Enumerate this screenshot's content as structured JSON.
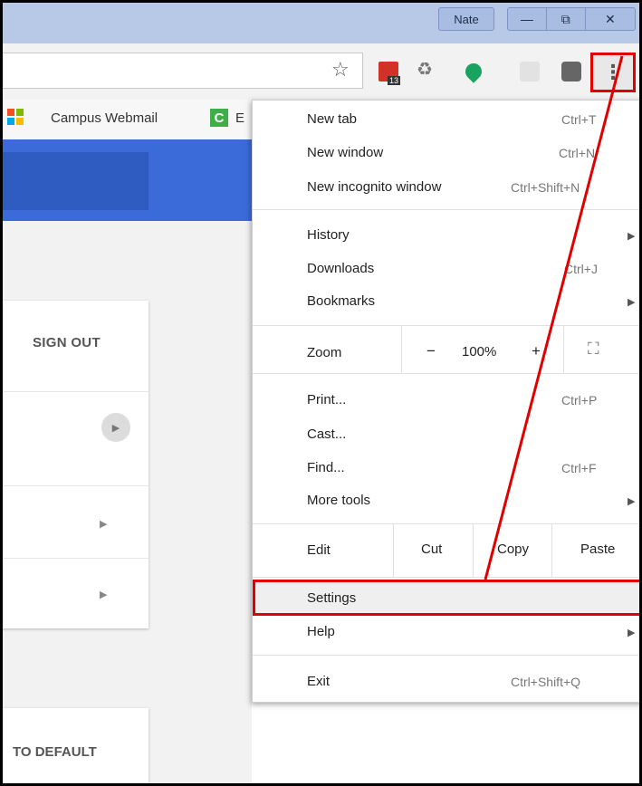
{
  "window": {
    "user_label": "Nate",
    "minimize_glyph": "—",
    "restore_glyph": "⧉",
    "close_glyph": "✕"
  },
  "toolbar": {
    "star_glyph": "☆",
    "recycle_glyph": "♻",
    "menu_glyph": "⋮",
    "accent_color": "#e00000"
  },
  "bookmarks": {
    "item1": "Campus Webmail",
    "item2_logo": "C",
    "item3_partial": "E"
  },
  "page": {
    "sign_out": "SIGN OUT",
    "arrow_glyph": "▶",
    "reset_partial": "TO DEFAULT"
  },
  "menu": {
    "new_tab": {
      "label": "New tab",
      "shortcut": "Ctrl+T"
    },
    "new_window": {
      "label": "New window",
      "shortcut": "Ctrl+N"
    },
    "new_incognito": {
      "label": "New incognito window",
      "shortcut": "Ctrl+Shift+N"
    },
    "history": {
      "label": "History"
    },
    "downloads": {
      "label": "Downloads",
      "shortcut": "Ctrl+J"
    },
    "bookmarks": {
      "label": "Bookmarks"
    },
    "zoom": {
      "label": "Zoom",
      "minus": "−",
      "value": "100%",
      "plus": "+",
      "fullscreen": "⛶"
    },
    "print": {
      "label": "Print...",
      "shortcut": "Ctrl+P"
    },
    "cast": {
      "label": "Cast..."
    },
    "find": {
      "label": "Find...",
      "shortcut": "Ctrl+F"
    },
    "more_tools": {
      "label": "More tools"
    },
    "edit": {
      "label": "Edit",
      "cut": "Cut",
      "copy": "Copy",
      "paste": "Paste"
    },
    "settings": {
      "label": "Settings"
    },
    "help": {
      "label": "Help"
    },
    "exit": {
      "label": "Exit",
      "shortcut": "Ctrl+Shift+Q"
    },
    "submenu_glyph": "▶"
  }
}
